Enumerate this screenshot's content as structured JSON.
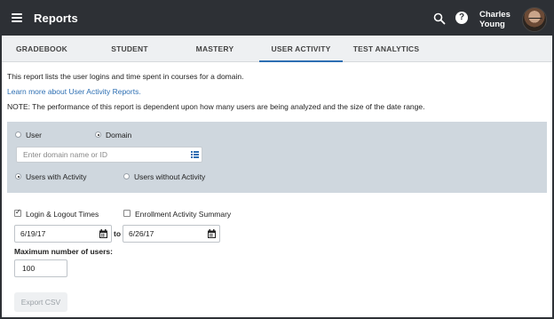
{
  "appbar": {
    "title": "Reports",
    "user_name": "Charles Young",
    "icons": [
      "menu-icon",
      "search-icon",
      "help-icon"
    ],
    "help_glyph": "?",
    "bg_color": "#2d3035"
  },
  "tabs": [
    {
      "label": "GRADEBOOK",
      "active": false
    },
    {
      "label": "STUDENT",
      "active": false
    },
    {
      "label": "MASTERY",
      "active": false
    },
    {
      "label": "USER ACTIVITY",
      "active": true
    },
    {
      "label": "TEST ANALYTICS",
      "active": false
    }
  ],
  "intro": {
    "description": "This report lists the user logins and time spent in courses for a domain.",
    "learn_more_link": "Learn more about User Activity Reports.",
    "note": "NOTE: The performance of this report is dependent upon how many users are being analyzed and the size of the date range."
  },
  "filters": {
    "scope_options": [
      {
        "label": "User",
        "selected": false
      },
      {
        "label": "Domain",
        "selected": true
      }
    ],
    "domain_placeholder": "Enter domain name or ID",
    "activity_options": [
      {
        "label": "Users with Activity",
        "selected": true
      },
      {
        "label": "Users without Activity",
        "selected": false
      }
    ],
    "panel_color": "#cfd7de"
  },
  "options": {
    "login_logout": {
      "label": "Login & Logout Times",
      "checked": true
    },
    "enrollment_summary": {
      "label": "Enrollment Activity Summary",
      "checked": false
    },
    "start_date": "6/19/17",
    "to_label": "to",
    "end_date": "6/26/17",
    "max_users_label": "Maximum number of users:",
    "max_users_value": "100"
  },
  "actions": {
    "export_label": "Export CSV"
  },
  "colors": {
    "accent": "#2d6fb3"
  }
}
